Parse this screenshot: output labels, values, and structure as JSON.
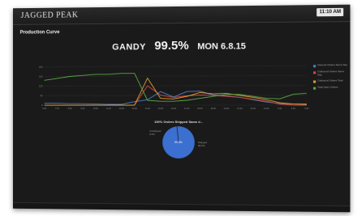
{
  "app": {
    "brand": "JAGGED PEAK",
    "clock": "11:10 AM"
  },
  "panel": {
    "title": "Production Curve"
  },
  "headline": {
    "site": "GANDY",
    "percent": "99.5%",
    "date": "MON 6.8.15"
  },
  "colors": {
    "blue": "#4a7fd4",
    "red": "#d9483b",
    "orange": "#e0a030",
    "green": "#5ba84a"
  },
  "chart_data": [
    {
      "type": "line",
      "title": "",
      "ylim": [
        0,
        200
      ],
      "y_ticks": [
        "200",
        "150",
        "100",
        "50",
        "0"
      ],
      "categories": [
        "6:00",
        "7:00",
        "8:00",
        "9:00",
        "10:00",
        "11:00",
        "12:00",
        "13:00",
        "14:00",
        "15:00",
        "16:00",
        "17:00",
        "18:00",
        "19:00",
        "20:00",
        "21:00",
        "22:00",
        "23:00",
        "0:00",
        "1:00",
        "2:00"
      ],
      "series": [
        {
          "name": "Inbound Orders Same Day",
          "color": "#4a7fd4",
          "values": [
            10,
            10,
            8,
            8,
            6,
            4,
            4,
            18,
            28,
            70,
            42,
            70,
            72,
            52,
            48,
            40,
            28,
            16,
            8,
            6,
            6
          ]
        },
        {
          "name": "Outbound Orders Same Day",
          "color": "#d9483b",
          "values": [
            0,
            0,
            0,
            0,
            0,
            0,
            0,
            0,
            100,
            52,
            40,
            48,
            52,
            50,
            45,
            40,
            30,
            20,
            5,
            0,
            0
          ]
        },
        {
          "name": "Outbound Orders Total",
          "color": "#e0a030",
          "values": [
            0,
            0,
            0,
            0,
            0,
            0,
            0,
            0,
            140,
            35,
            32,
            45,
            65,
            58,
            60,
            50,
            40,
            28,
            12,
            6,
            4
          ]
        },
        {
          "name": "Total Open Orders",
          "color": "#5ba84a",
          "values": [
            130,
            140,
            150,
            155,
            160,
            160,
            165,
            165,
            25,
            20,
            20,
            25,
            35,
            45,
            55,
            55,
            45,
            35,
            32,
            55,
            60
          ]
        }
      ]
    },
    {
      "type": "pie",
      "title": "100% Orders Shipped Same d...",
      "slices": [
        {
          "label": "Shipped",
          "value": 99.5,
          "color": "#3b6fd0",
          "display": "99.5%"
        },
        {
          "label": "Unshipped",
          "value": 0.5,
          "color": "#d9483b",
          "display": "0.5%"
        }
      ]
    }
  ]
}
